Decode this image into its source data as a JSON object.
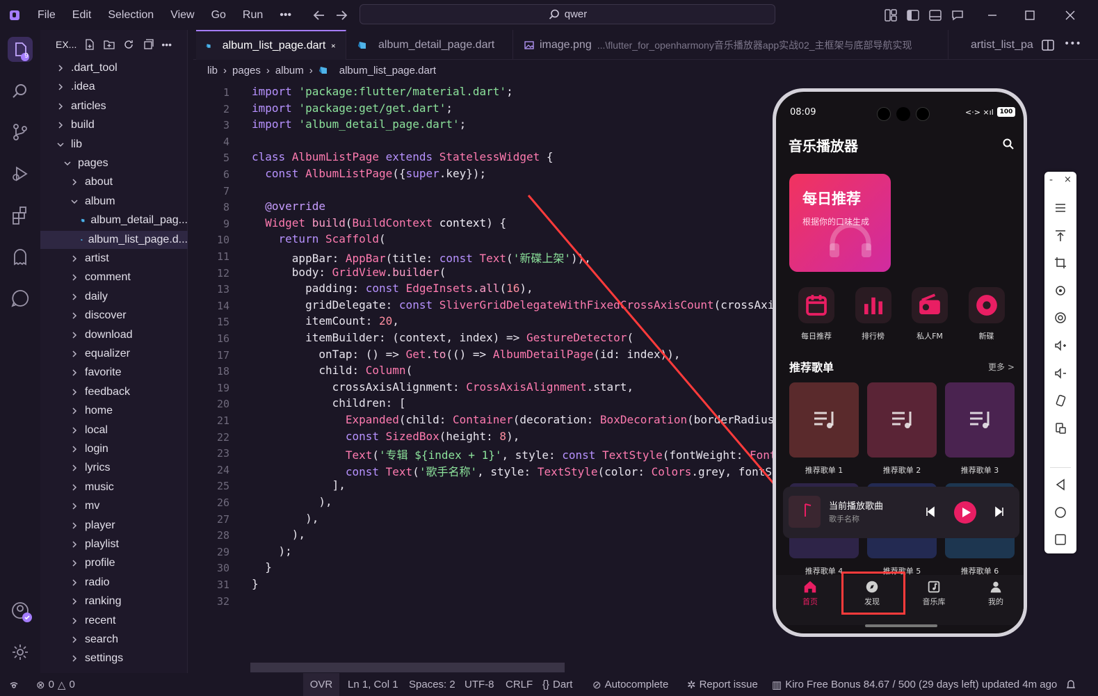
{
  "menu": [
    "File",
    "Edit",
    "Selection",
    "View",
    "Go",
    "Run"
  ],
  "search": {
    "text": "qwer"
  },
  "activity": {
    "badge": "9"
  },
  "explorer": {
    "title": "EX...",
    "items": [
      {
        "label": ".dart_tool",
        "level": 0,
        "type": "folder",
        "open": false
      },
      {
        "label": ".idea",
        "level": 0,
        "type": "folder",
        "open": false
      },
      {
        "label": "articles",
        "level": 0,
        "type": "folder",
        "open": false
      },
      {
        "label": "build",
        "level": 0,
        "type": "folder",
        "open": false
      },
      {
        "label": "lib",
        "level": 0,
        "type": "folder",
        "open": true
      },
      {
        "label": "pages",
        "level": 1,
        "type": "folder",
        "open": true
      },
      {
        "label": "about",
        "level": 2,
        "type": "folder",
        "open": false
      },
      {
        "label": "album",
        "level": 2,
        "type": "folder",
        "open": true
      },
      {
        "label": "album_detail_pag...",
        "level": 3,
        "type": "file",
        "open": false
      },
      {
        "label": "album_list_page.d...",
        "level": 3,
        "type": "file",
        "open": false,
        "selected": true
      },
      {
        "label": "artist",
        "level": 2,
        "type": "folder",
        "open": false
      },
      {
        "label": "comment",
        "level": 2,
        "type": "folder",
        "open": false
      },
      {
        "label": "daily",
        "level": 2,
        "type": "folder",
        "open": false
      },
      {
        "label": "discover",
        "level": 2,
        "type": "folder",
        "open": false
      },
      {
        "label": "download",
        "level": 2,
        "type": "folder",
        "open": false
      },
      {
        "label": "equalizer",
        "level": 2,
        "type": "folder",
        "open": false
      },
      {
        "label": "favorite",
        "level": 2,
        "type": "folder",
        "open": false
      },
      {
        "label": "feedback",
        "level": 2,
        "type": "folder",
        "open": false
      },
      {
        "label": "home",
        "level": 2,
        "type": "folder",
        "open": false
      },
      {
        "label": "local",
        "level": 2,
        "type": "folder",
        "open": false
      },
      {
        "label": "login",
        "level": 2,
        "type": "folder",
        "open": false
      },
      {
        "label": "lyrics",
        "level": 2,
        "type": "folder",
        "open": false
      },
      {
        "label": "music",
        "level": 2,
        "type": "folder",
        "open": false
      },
      {
        "label": "mv",
        "level": 2,
        "type": "folder",
        "open": false
      },
      {
        "label": "player",
        "level": 2,
        "type": "folder",
        "open": false
      },
      {
        "label": "playlist",
        "level": 2,
        "type": "folder",
        "open": false
      },
      {
        "label": "profile",
        "level": 2,
        "type": "folder",
        "open": false
      },
      {
        "label": "radio",
        "level": 2,
        "type": "folder",
        "open": false
      },
      {
        "label": "ranking",
        "level": 2,
        "type": "folder",
        "open": false
      },
      {
        "label": "recent",
        "level": 2,
        "type": "folder",
        "open": false
      },
      {
        "label": "search",
        "level": 2,
        "type": "folder",
        "open": false
      },
      {
        "label": "settings",
        "level": 2,
        "type": "folder",
        "open": false
      }
    ]
  },
  "tabs": [
    {
      "label": "album_list_page.dart",
      "active": true,
      "icon": "dart-icon"
    },
    {
      "label": "album_detail_page.dart",
      "active": false,
      "icon": "dart-icon"
    },
    {
      "label": "image.png",
      "path": "...\\flutter_for_openharmony音乐播放器app实战02_主框架与底部导航实现",
      "active": false,
      "icon": "image-icon"
    },
    {
      "label": "artist_list_pa",
      "active": false,
      "icon": "dart-icon"
    }
  ],
  "breadcrumb": [
    "lib",
    "pages",
    "album",
    "album_list_page.dart"
  ],
  "code": [
    [
      [
        "kw",
        "import "
      ],
      [
        "str",
        "'package:flutter/material.dart'"
      ],
      [
        "",
        ";"
      ]
    ],
    [
      [
        "kw",
        "import "
      ],
      [
        "str",
        "'package:get/get.dart'"
      ],
      [
        "",
        ";"
      ]
    ],
    [
      [
        "kw",
        "import "
      ],
      [
        "str",
        "'album_detail_page.dart'"
      ],
      [
        "",
        ";"
      ]
    ],
    [],
    [
      [
        "kw",
        "class "
      ],
      [
        "typ",
        "AlbumListPage "
      ],
      [
        "kw",
        "extends "
      ],
      [
        "typ",
        "StatelessWidget "
      ],
      [
        "",
        "{"
      ]
    ],
    [
      [
        "",
        "  "
      ],
      [
        "kw",
        "const "
      ],
      [
        "typ",
        "AlbumListPage"
      ],
      [
        "",
        "({"
      ],
      [
        "kw",
        "super"
      ],
      [
        "",
        ".key});"
      ]
    ],
    [],
    [
      [
        "",
        "  "
      ],
      [
        "dec",
        "@override"
      ]
    ],
    [
      [
        "",
        "  "
      ],
      [
        "typ",
        "Widget "
      ],
      [
        "fn",
        "build"
      ],
      [
        "",
        "("
      ],
      [
        "typ",
        "BuildContext "
      ],
      [
        "prm",
        "context"
      ],
      [
        "",
        ") {"
      ]
    ],
    [
      [
        "",
        "    "
      ],
      [
        "kw",
        "return "
      ],
      [
        "typ",
        "Scaffold"
      ],
      [
        "",
        "("
      ]
    ],
    [
      [
        "",
        "      appBar: "
      ],
      [
        "typ",
        "AppBar"
      ],
      [
        "",
        "(title: "
      ],
      [
        "kw",
        "const "
      ],
      [
        "typ",
        "Text"
      ],
      [
        "",
        "("
      ],
      [
        "str",
        "'新碟上架'"
      ],
      [
        "",
        ")),"
      ]
    ],
    [
      [
        "",
        "      body: "
      ],
      [
        "typ",
        "GridView"
      ],
      [
        "",
        "."
      ],
      [
        "fn",
        "builder"
      ],
      [
        "",
        "("
      ]
    ],
    [
      [
        "",
        "        padding: "
      ],
      [
        "kw",
        "const "
      ],
      [
        "typ",
        "EdgeInsets"
      ],
      [
        "",
        "."
      ],
      [
        "fn",
        "all"
      ],
      [
        "",
        "("
      ],
      [
        "num",
        "16"
      ],
      [
        "",
        "),"
      ]
    ],
    [
      [
        "",
        "        gridDelegate: "
      ],
      [
        "kw",
        "const "
      ],
      [
        "typ",
        "SliverGridDelegateWithFixedCrossAxisCount"
      ],
      [
        "",
        "(crossAxi"
      ]
    ],
    [
      [
        "",
        "        itemCount: "
      ],
      [
        "num",
        "20"
      ],
      [
        "",
        ","
      ]
    ],
    [
      [
        "",
        "        itemBuilder: (context, index) => "
      ],
      [
        "typ",
        "GestureDetector"
      ],
      [
        "",
        "("
      ]
    ],
    [
      [
        "",
        "          onTap: () => "
      ],
      [
        "typ",
        "Get"
      ],
      [
        "",
        "."
      ],
      [
        "fn",
        "to"
      ],
      [
        "",
        "(() => "
      ],
      [
        "typ",
        "AlbumDetailPage"
      ],
      [
        "",
        "(id: index)),"
      ]
    ],
    [
      [
        "",
        "          child: "
      ],
      [
        "typ",
        "Column"
      ],
      [
        "",
        "("
      ]
    ],
    [
      [
        "",
        "            crossAxisAlignment: "
      ],
      [
        "typ",
        "CrossAxisAlignment"
      ],
      [
        "",
        ".start,"
      ]
    ],
    [
      [
        "",
        "            children: ["
      ]
    ],
    [
      [
        "",
        "              "
      ],
      [
        "typ",
        "Expanded"
      ],
      [
        "",
        "(child: "
      ],
      [
        "typ",
        "Container"
      ],
      [
        "",
        "(decoration: "
      ],
      [
        "typ",
        "BoxDecoration"
      ],
      [
        "",
        "(borderRadius"
      ]
    ],
    [
      [
        "",
        "              "
      ],
      [
        "kw",
        "const "
      ],
      [
        "typ",
        "SizedBox"
      ],
      [
        "",
        "(height: "
      ],
      [
        "num",
        "8"
      ],
      [
        "",
        "),"
      ]
    ],
    [
      [
        "",
        "              "
      ],
      [
        "typ",
        "Text"
      ],
      [
        "",
        "("
      ],
      [
        "str",
        "'专辑 ${index + 1}'"
      ],
      [
        "",
        ", style: "
      ],
      [
        "kw",
        "const "
      ],
      [
        "typ",
        "TextStyle"
      ],
      [
        "",
        "(fontWeight: "
      ],
      [
        "typ",
        "Font"
      ]
    ],
    [
      [
        "",
        "              "
      ],
      [
        "kw",
        "const "
      ],
      [
        "typ",
        "Text"
      ],
      [
        "",
        "("
      ],
      [
        "str",
        "'歌手名称'"
      ],
      [
        "",
        ", style: "
      ],
      [
        "typ",
        "TextStyle"
      ],
      [
        "",
        "(color: "
      ],
      [
        "typ",
        "Colors"
      ],
      [
        "",
        ".grey, fontS"
      ]
    ],
    [
      [
        "",
        "            ],"
      ]
    ],
    [
      [
        "",
        "          ),"
      ]
    ],
    [
      [
        "",
        "        ),"
      ]
    ],
    [
      [
        "",
        "      ),"
      ]
    ],
    [
      [
        "",
        "    );"
      ]
    ],
    [
      [
        "",
        "  }"
      ]
    ],
    [
      [
        "",
        "}"
      ]
    ],
    []
  ],
  "phone": {
    "time": "08:09",
    "battery": "100",
    "app_title": "音乐播放器",
    "daily_card": {
      "title": "每日推荐",
      "subtitle": "根据你的口味生成"
    },
    "quick_items": [
      {
        "label": "每日推荐",
        "icon": "calendar-icon"
      },
      {
        "label": "排行榜",
        "icon": "bar-chart-icon"
      },
      {
        "label": "私人FM",
        "icon": "radio-icon"
      },
      {
        "label": "新碟",
        "icon": "disc-icon"
      }
    ],
    "section_title": "推荐歌单",
    "more": "更多 >",
    "playlists": [
      {
        "label": "推荐歌单 1",
        "color": "#5a2a2c"
      },
      {
        "label": "推荐歌单 2",
        "color": "#5a2436"
      },
      {
        "label": "推荐歌单 3",
        "color": "#4a2350"
      },
      {
        "label": "推荐歌单 4",
        "color": "#2e2448"
      },
      {
        "label": "推荐歌单 5",
        "color": "#232a52"
      },
      {
        "label": "推荐歌单 6",
        "color": "#1d3650"
      }
    ],
    "now_playing": {
      "title": "当前播放歌曲",
      "artist": "歌手名称"
    },
    "bottom_nav": [
      {
        "label": "首页",
        "icon": "home-icon",
        "active": true
      },
      {
        "label": "发现",
        "icon": "compass-icon",
        "active": false
      },
      {
        "label": "音乐库",
        "icon": "library-icon",
        "active": false
      },
      {
        "label": "我的",
        "icon": "person-icon",
        "active": false
      }
    ]
  },
  "status": {
    "errors": "0",
    "warnings": "0",
    "mode": "OVR",
    "position": "Ln 1, Col 1",
    "spaces": "Spaces: 2",
    "encoding": "UTF-8",
    "eol": "CRLF",
    "language": "Dart",
    "autocomplete": "Autocomplete",
    "report": "Report issue",
    "bonus": "Kiro Free Bonus 84.67 / 500 (29 days left) updated 4m ago"
  },
  "colors": {
    "accent": "#e91e63",
    "purple": "#a57dff",
    "background": "#1b1625"
  }
}
